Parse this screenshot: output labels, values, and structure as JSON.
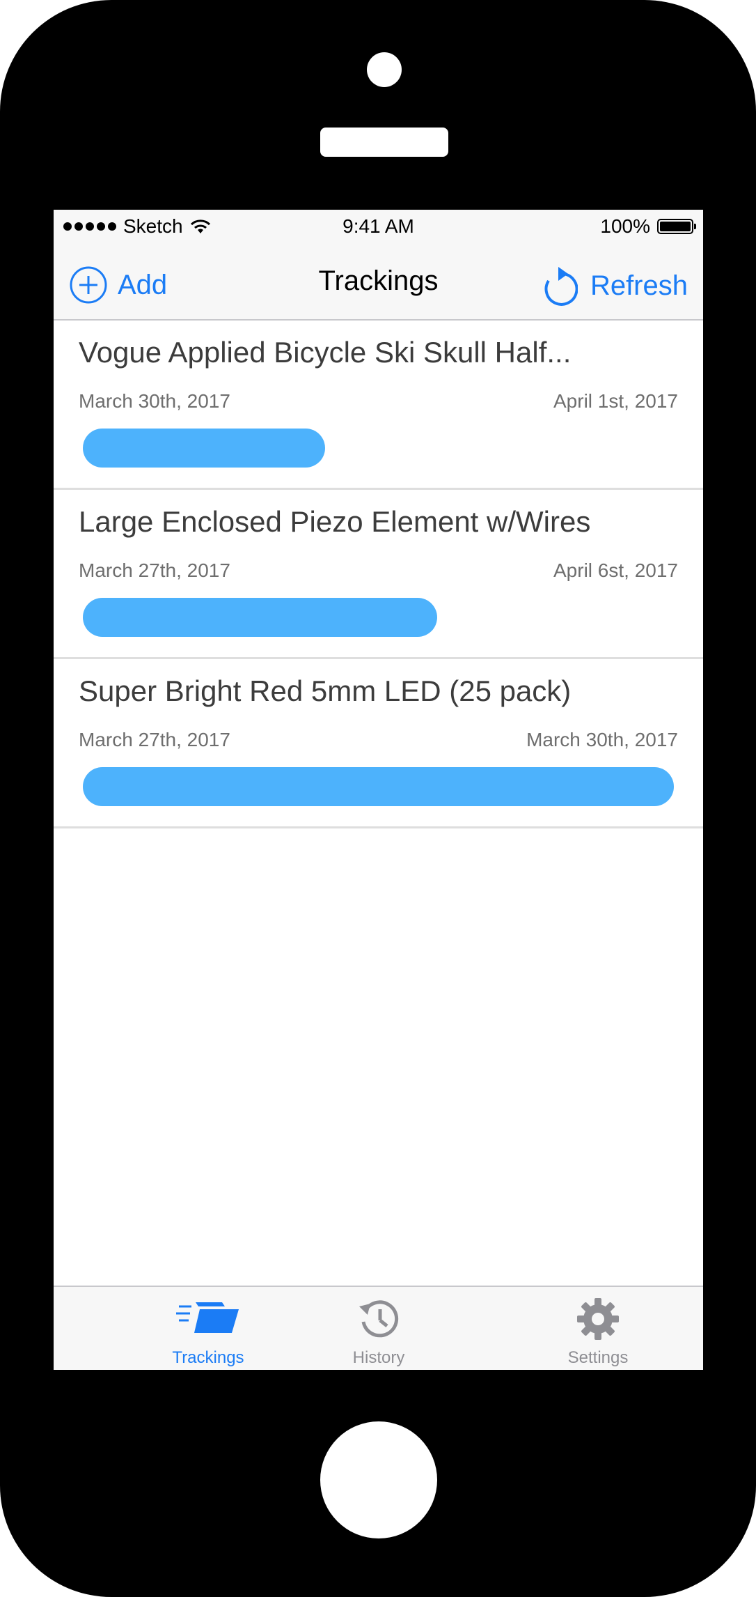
{
  "status_bar": {
    "carrier": "Sketch",
    "time": "9:41 AM",
    "battery": "100%"
  },
  "nav": {
    "add_label": "Add",
    "title": "Trackings",
    "refresh_label": "Refresh"
  },
  "trackings": [
    {
      "title": "Vogue Applied Bicycle Ski Skull Half...",
      "start": "March 30th, 2017",
      "end": "April 1st, 2017",
      "progress": 0.41
    },
    {
      "title": "Large Enclosed Piezo Element w/Wires",
      "start": "March 27th, 2017",
      "end": "April 6st, 2017",
      "progress": 0.6
    },
    {
      "title": "Super Bright Red 5mm LED (25 pack)",
      "start": "March 27th, 2017",
      "end": "March 30th, 2017",
      "progress": 1.0
    }
  ],
  "tabs": [
    {
      "label": "Trackings",
      "icon": "trackings-icon",
      "active": true
    },
    {
      "label": "History",
      "icon": "history-icon",
      "active": false
    },
    {
      "label": "Settings",
      "icon": "gear-icon",
      "active": false
    }
  ],
  "colors": {
    "accent": "#1b7cf5",
    "progress": "#4db2fc",
    "inactive": "#8e8e93"
  }
}
